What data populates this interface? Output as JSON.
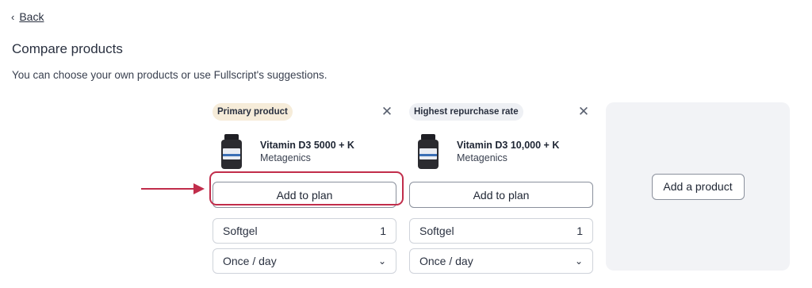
{
  "nav": {
    "back_label": "Back"
  },
  "page": {
    "title": "Compare products",
    "subtitle": "You can choose your own products or use Fullscript's suggestions."
  },
  "columns": [
    {
      "badge": "Primary product",
      "product_name": "Vitamin D3 5000 + K",
      "brand": "Metagenics",
      "add_button": "Add to plan",
      "dosage_form": "Softgel",
      "quantity": "1",
      "frequency": "Once / day"
    },
    {
      "badge": "Highest repurchase rate",
      "product_name": "Vitamin D3 10,000 + K",
      "brand": "Metagenics",
      "add_button": "Add to plan",
      "dosage_form": "Softgel",
      "quantity": "1",
      "frequency": "Once / day"
    }
  ],
  "add_product": {
    "label": "Add a product"
  },
  "colors": {
    "highlight": "#c12d4b",
    "primary_badge_bg": "#f6ecd9",
    "alt_badge_bg": "#eef0f4",
    "add_card_bg": "#f2f3f6"
  },
  "icons": {
    "back": "chevron-left-icon",
    "close": "close-icon",
    "dropdown": "chevron-down-icon",
    "annotation": "arrow-right-icon"
  }
}
